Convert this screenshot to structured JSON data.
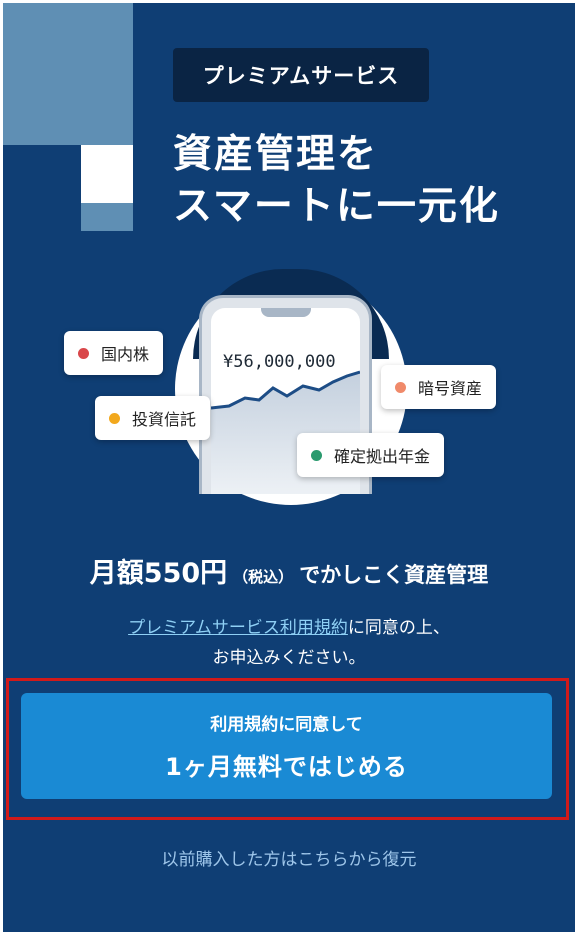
{
  "badge": {
    "label": "プレミアムサービス"
  },
  "headline": {
    "line1": "資産管理を",
    "line2": "スマートに一元化"
  },
  "illustration": {
    "amount": "¥56,000,000",
    "chips": [
      {
        "label": "国内株",
        "color": "#d9474a"
      },
      {
        "label": "投資信託",
        "color": "#f2a81d"
      },
      {
        "label": "暗号資産",
        "color": "#f08a6a"
      },
      {
        "label": "確定拠出年金",
        "color": "#2a9a6e"
      }
    ]
  },
  "pricing": {
    "main": "月額550円",
    "tax_note": "（税込）",
    "rest": "でかしこく資産管理"
  },
  "consent": {
    "link_text": "プレミアムサービス利用規約",
    "after_link": "に同意の上、",
    "line2": "お申込みください。"
  },
  "cta": {
    "line1": "利用規約に同意して",
    "line2": "1ヶ月無料ではじめる"
  },
  "restore": {
    "label": "以前購入した方はこちらから復元"
  },
  "colors": {
    "background": "#0f3e74",
    "button": "#1a8ad4",
    "link": "#8fd0f5",
    "highlight": "#d11a1a"
  }
}
